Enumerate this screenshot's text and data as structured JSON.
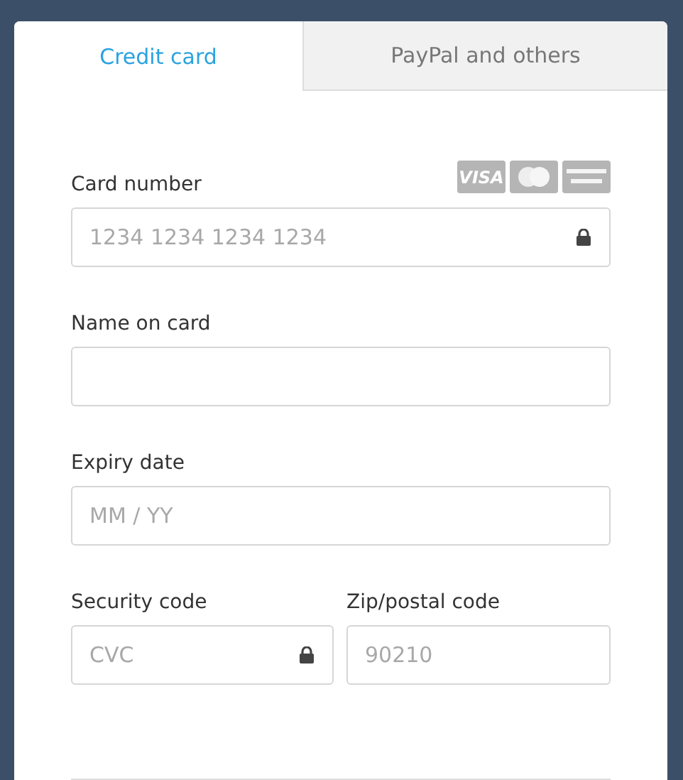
{
  "tabs": [
    {
      "label": "Credit card",
      "selected": true
    },
    {
      "label": "PayPal and others",
      "selected": false
    }
  ],
  "card_brands": [
    {
      "kind": "visa",
      "label": "VISA"
    },
    {
      "kind": "mastercard"
    },
    {
      "kind": "amex"
    }
  ],
  "fields": [
    {
      "label": "Card number",
      "placeholder": "1234 1234 1234 1234",
      "locked": true
    },
    {
      "label": "Name on card",
      "locked": false
    },
    {
      "label": "Expiry date",
      "placeholder": "MM / YY",
      "locked": false
    }
  ],
  "pair": [
    {
      "label": "Security code",
      "placeholder": "CVC",
      "locked": true
    },
    {
      "label": "Zip/postal code",
      "placeholder": "90210",
      "locked": false
    }
  ]
}
